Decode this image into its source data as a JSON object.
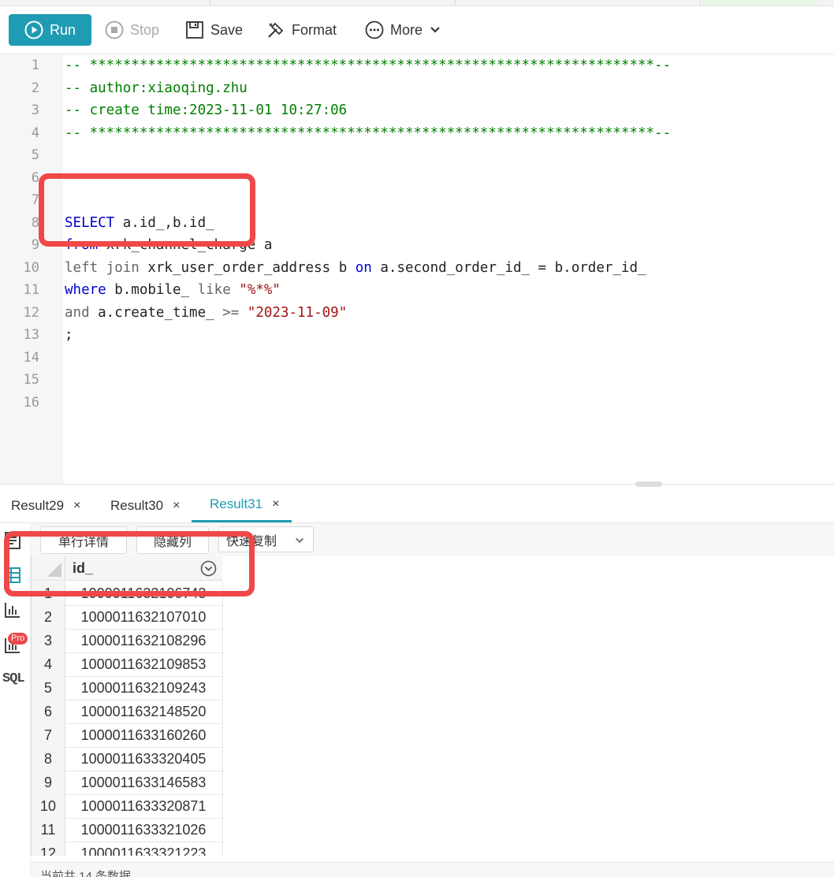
{
  "toolbar": {
    "run_label": "Run",
    "stop_label": "Stop",
    "save_label": "Save",
    "format_label": "Format",
    "more_label": "More"
  },
  "editor": {
    "lines": [
      {
        "n": "1"
      },
      {
        "n": "2"
      },
      {
        "n": "3"
      },
      {
        "n": "4"
      },
      {
        "n": "5"
      },
      {
        "n": "6"
      },
      {
        "n": "7"
      },
      {
        "n": "8"
      },
      {
        "n": "9"
      },
      {
        "n": "10"
      },
      {
        "n": "11"
      },
      {
        "n": "12"
      },
      {
        "n": "13"
      },
      {
        "n": "14"
      },
      {
        "n": "15"
      },
      {
        "n": "16"
      }
    ],
    "code": {
      "l1": "-- ********************************************************************--",
      "l2": "-- author:xiaoqing.zhu",
      "l3": "-- create time:2023-11-01 10:27:06",
      "l4": "-- ********************************************************************--",
      "l8_kw": "SELECT",
      "l8_rest": " a.id_,b.id_",
      "l9_kw": "from",
      "l9_rest": " xrk_channel_charge a",
      "l10_kw": "left join",
      "l10_mid": " xrk_user_order_address b ",
      "l10_on": "on",
      "l10_rest": " a.second_order_id_ = b.order_id_",
      "l11_kw": "where",
      "l11_mid": " b.mobile_ ",
      "l11_like": "like",
      "l11_str": " \"%*%\"",
      "l12_kw": "and",
      "l12_mid": " a.create_time_ ",
      "l12_op": ">=",
      "l12_str": " \"2023-11-09\"",
      "l13": ";"
    }
  },
  "result_tabs": [
    {
      "label": "Result29",
      "close": "×"
    },
    {
      "label": "Result30",
      "close": "×"
    },
    {
      "label": "Result31",
      "close": "×"
    }
  ],
  "sub_toolbar": {
    "row_detail": "单行详情",
    "hide_cols": "隐藏列",
    "quick_copy": "快速复制"
  },
  "side_icons": [
    "list-icon",
    "table-icon",
    "bar-chart-icon",
    "pro-chart-icon",
    "sql-icon"
  ],
  "pro_badge": "Pro",
  "sql_label": "SQL",
  "table": {
    "column": "id_",
    "rows": [
      {
        "n": "1",
        "id": "1000011632106743"
      },
      {
        "n": "2",
        "id": "1000011632107010"
      },
      {
        "n": "3",
        "id": "1000011632108296"
      },
      {
        "n": "4",
        "id": "1000011632109853"
      },
      {
        "n": "5",
        "id": "1000011632109243"
      },
      {
        "n": "6",
        "id": "1000011632148520"
      },
      {
        "n": "7",
        "id": "1000011633160260"
      },
      {
        "n": "8",
        "id": "1000011633320405"
      },
      {
        "n": "9",
        "id": "1000011633146583"
      },
      {
        "n": "10",
        "id": "1000011633320871"
      },
      {
        "n": "11",
        "id": "1000011633321026"
      },
      {
        "n": "12",
        "id": "1000011633321223"
      }
    ]
  },
  "status": "当前共 14 条数据",
  "colors": {
    "accent": "#1f9bb3",
    "annotation": "#f04848",
    "comment": "#008000",
    "keyword": "#0000cc"
  }
}
